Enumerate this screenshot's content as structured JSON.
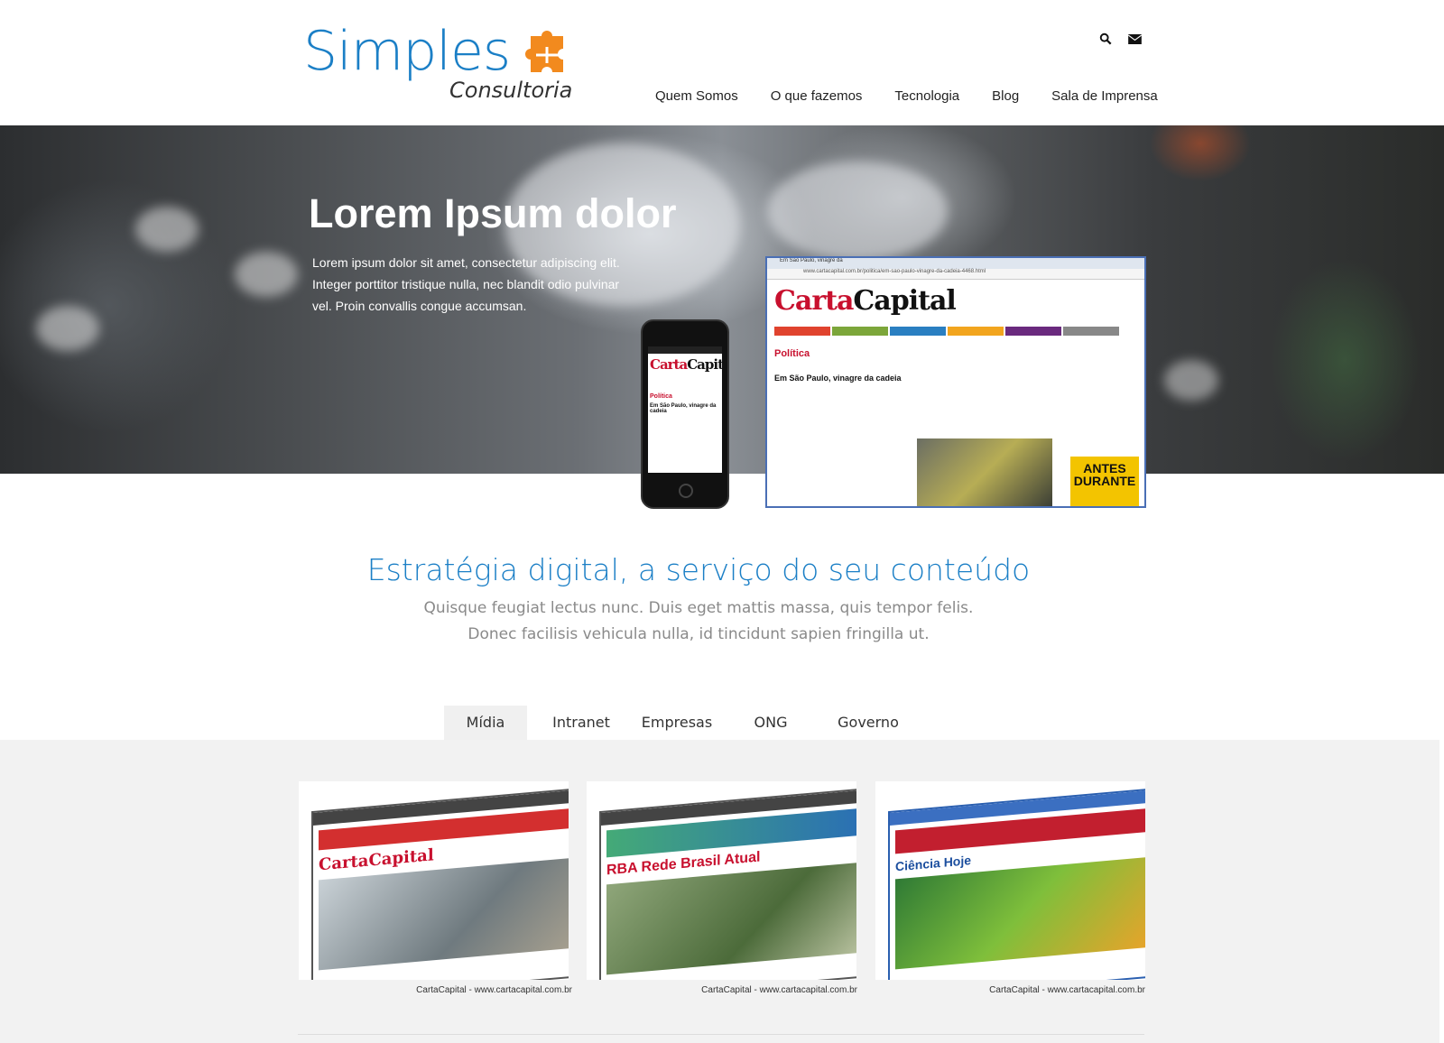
{
  "brand": {
    "name": "Simples",
    "sub": "Consultoria",
    "blue": "#1b7fc6",
    "orange": "#f28a1e"
  },
  "top_icons": [
    "search-icon",
    "envelope-icon"
  ],
  "nav": [
    {
      "label": "Quem Somos"
    },
    {
      "label": "O que fazemos"
    },
    {
      "label": "Tecnologia"
    },
    {
      "label": "Blog"
    },
    {
      "label": "Sala de Imprensa"
    }
  ],
  "hero": {
    "title": "Lorem Ipsum dolor",
    "text": "Lorem ipsum dolor sit amet, consectetur adipiscing elit. Integer porttitor tristique nulla, nec blandit odio pulvinar vel. Proin convallis congue accumsan.",
    "mockup": {
      "tab_label": "Em São Paulo, vinagre da",
      "url": "www.cartacapital.com.br/politica/em-sao-paulo-vinagre-da-cadeia-4468.html",
      "logo_a": "Carta",
      "logo_b": "Capital",
      "section": "Política",
      "headline": "Em São Paulo, vinagre da cadeia",
      "ad": "ANTES DURANTE"
    }
  },
  "section": {
    "title": "Estratégia digital, a serviço do seu conteúdo",
    "sub1": "Quisque feugiat lectus nunc. Duis eget mattis massa, quis tempor felis.",
    "sub2": "Donec facilisis vehicula nulla, id tincidunt sapien fringilla ut."
  },
  "tabs": [
    {
      "label": "Mídia",
      "active": true
    },
    {
      "label": "Intranet",
      "active": false
    },
    {
      "label": "Empresas",
      "active": false
    },
    {
      "label": "ONG",
      "active": false
    },
    {
      "label": "Governo",
      "active": false
    }
  ],
  "cards": [
    {
      "caption": "CartaCapital - www.cartacapital.com.br",
      "site": "CartaCapital"
    },
    {
      "caption": "CartaCapital - www.cartacapital.com.br",
      "site": "RBA Rede Brasil Atual"
    },
    {
      "caption": "CartaCapital - www.cartacapital.com.br",
      "site": "Ciência Hoje"
    }
  ]
}
